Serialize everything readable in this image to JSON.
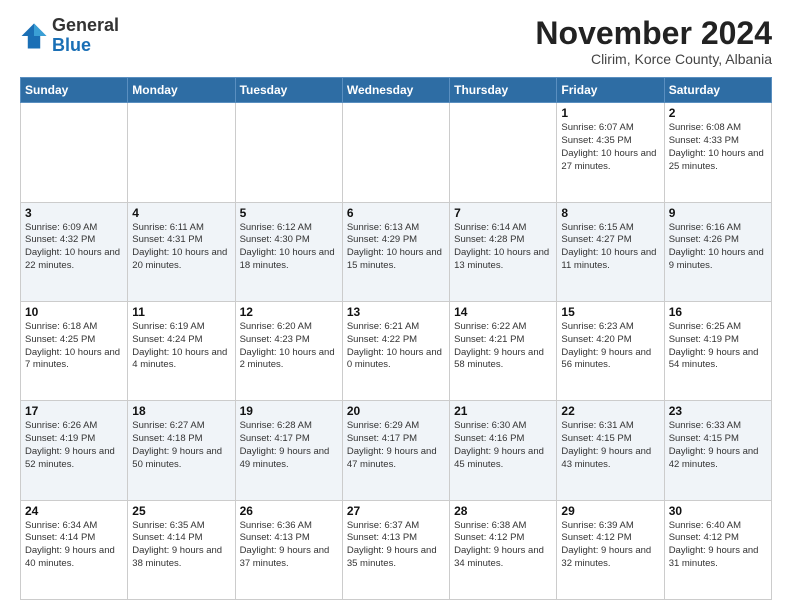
{
  "header": {
    "logo_general": "General",
    "logo_blue": "Blue",
    "month": "November 2024",
    "location": "Clirim, Korce County, Albania"
  },
  "weekdays": [
    "Sunday",
    "Monday",
    "Tuesday",
    "Wednesday",
    "Thursday",
    "Friday",
    "Saturday"
  ],
  "weeks": [
    [
      {
        "day": "",
        "info": ""
      },
      {
        "day": "",
        "info": ""
      },
      {
        "day": "",
        "info": ""
      },
      {
        "day": "",
        "info": ""
      },
      {
        "day": "",
        "info": ""
      },
      {
        "day": "1",
        "info": "Sunrise: 6:07 AM\nSunset: 4:35 PM\nDaylight: 10 hours and 27 minutes."
      },
      {
        "day": "2",
        "info": "Sunrise: 6:08 AM\nSunset: 4:33 PM\nDaylight: 10 hours and 25 minutes."
      }
    ],
    [
      {
        "day": "3",
        "info": "Sunrise: 6:09 AM\nSunset: 4:32 PM\nDaylight: 10 hours and 22 minutes."
      },
      {
        "day": "4",
        "info": "Sunrise: 6:11 AM\nSunset: 4:31 PM\nDaylight: 10 hours and 20 minutes."
      },
      {
        "day": "5",
        "info": "Sunrise: 6:12 AM\nSunset: 4:30 PM\nDaylight: 10 hours and 18 minutes."
      },
      {
        "day": "6",
        "info": "Sunrise: 6:13 AM\nSunset: 4:29 PM\nDaylight: 10 hours and 15 minutes."
      },
      {
        "day": "7",
        "info": "Sunrise: 6:14 AM\nSunset: 4:28 PM\nDaylight: 10 hours and 13 minutes."
      },
      {
        "day": "8",
        "info": "Sunrise: 6:15 AM\nSunset: 4:27 PM\nDaylight: 10 hours and 11 minutes."
      },
      {
        "day": "9",
        "info": "Sunrise: 6:16 AM\nSunset: 4:26 PM\nDaylight: 10 hours and 9 minutes."
      }
    ],
    [
      {
        "day": "10",
        "info": "Sunrise: 6:18 AM\nSunset: 4:25 PM\nDaylight: 10 hours and 7 minutes."
      },
      {
        "day": "11",
        "info": "Sunrise: 6:19 AM\nSunset: 4:24 PM\nDaylight: 10 hours and 4 minutes."
      },
      {
        "day": "12",
        "info": "Sunrise: 6:20 AM\nSunset: 4:23 PM\nDaylight: 10 hours and 2 minutes."
      },
      {
        "day": "13",
        "info": "Sunrise: 6:21 AM\nSunset: 4:22 PM\nDaylight: 10 hours and 0 minutes."
      },
      {
        "day": "14",
        "info": "Sunrise: 6:22 AM\nSunset: 4:21 PM\nDaylight: 9 hours and 58 minutes."
      },
      {
        "day": "15",
        "info": "Sunrise: 6:23 AM\nSunset: 4:20 PM\nDaylight: 9 hours and 56 minutes."
      },
      {
        "day": "16",
        "info": "Sunrise: 6:25 AM\nSunset: 4:19 PM\nDaylight: 9 hours and 54 minutes."
      }
    ],
    [
      {
        "day": "17",
        "info": "Sunrise: 6:26 AM\nSunset: 4:19 PM\nDaylight: 9 hours and 52 minutes."
      },
      {
        "day": "18",
        "info": "Sunrise: 6:27 AM\nSunset: 4:18 PM\nDaylight: 9 hours and 50 minutes."
      },
      {
        "day": "19",
        "info": "Sunrise: 6:28 AM\nSunset: 4:17 PM\nDaylight: 9 hours and 49 minutes."
      },
      {
        "day": "20",
        "info": "Sunrise: 6:29 AM\nSunset: 4:17 PM\nDaylight: 9 hours and 47 minutes."
      },
      {
        "day": "21",
        "info": "Sunrise: 6:30 AM\nSunset: 4:16 PM\nDaylight: 9 hours and 45 minutes."
      },
      {
        "day": "22",
        "info": "Sunrise: 6:31 AM\nSunset: 4:15 PM\nDaylight: 9 hours and 43 minutes."
      },
      {
        "day": "23",
        "info": "Sunrise: 6:33 AM\nSunset: 4:15 PM\nDaylight: 9 hours and 42 minutes."
      }
    ],
    [
      {
        "day": "24",
        "info": "Sunrise: 6:34 AM\nSunset: 4:14 PM\nDaylight: 9 hours and 40 minutes."
      },
      {
        "day": "25",
        "info": "Sunrise: 6:35 AM\nSunset: 4:14 PM\nDaylight: 9 hours and 38 minutes."
      },
      {
        "day": "26",
        "info": "Sunrise: 6:36 AM\nSunset: 4:13 PM\nDaylight: 9 hours and 37 minutes."
      },
      {
        "day": "27",
        "info": "Sunrise: 6:37 AM\nSunset: 4:13 PM\nDaylight: 9 hours and 35 minutes."
      },
      {
        "day": "28",
        "info": "Sunrise: 6:38 AM\nSunset: 4:12 PM\nDaylight: 9 hours and 34 minutes."
      },
      {
        "day": "29",
        "info": "Sunrise: 6:39 AM\nSunset: 4:12 PM\nDaylight: 9 hours and 32 minutes."
      },
      {
        "day": "30",
        "info": "Sunrise: 6:40 AM\nSunset: 4:12 PM\nDaylight: 9 hours and 31 minutes."
      }
    ]
  ]
}
